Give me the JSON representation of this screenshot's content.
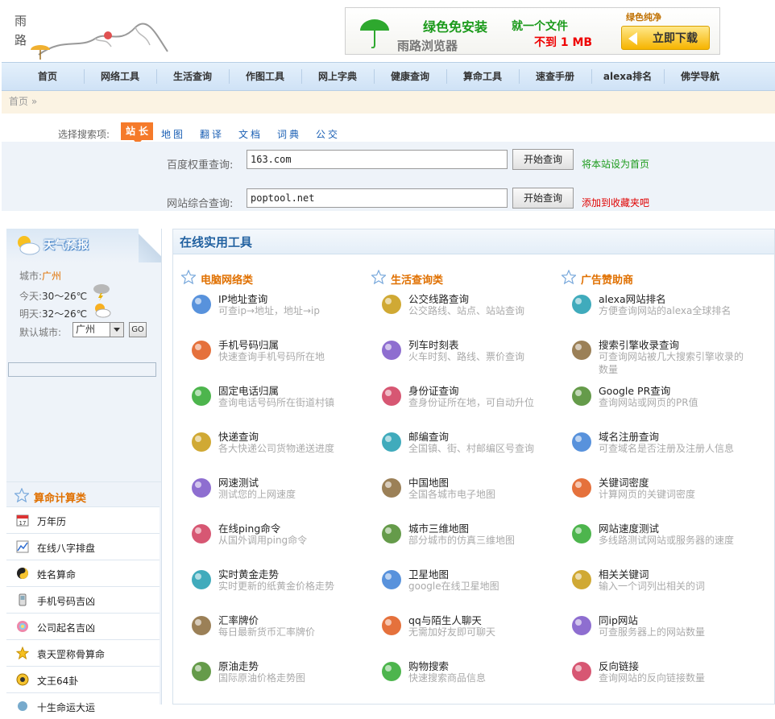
{
  "header": {
    "logo_text": "雨路",
    "banner": {
      "line1": "绿色免安装",
      "line2": "就一个文件",
      "line3": "雨路浏览器",
      "line4": "不到 1 MB",
      "line5": "绿色纯净",
      "download": "立即下载"
    }
  },
  "nav": {
    "items": [
      "首页",
      "网络工具",
      "生活查询",
      "作图工具",
      "网上字典",
      "健康查询",
      "算命工具",
      "速查手册",
      "alexa排名",
      "佛学导航"
    ]
  },
  "breadcrumb": "首页 »",
  "search": {
    "label": "选择搜索项:",
    "tabs": [
      "站长",
      "地图",
      "翻译",
      "文档",
      "词典",
      "公交"
    ],
    "rows": [
      {
        "label": "百度权重查询:",
        "value": "163.com",
        "button": "开始查询",
        "link": "将本站设为首页",
        "link_color": "#1a9a1a"
      },
      {
        "label": "网站综合查询:",
        "value": "poptool.net",
        "button": "开始查询",
        "link": "添加到收藏夹吧",
        "link_color": "#e00000"
      }
    ]
  },
  "weather": {
    "title": "天气预报",
    "city_label": "城市:",
    "city": "广州",
    "today_label": "今天:",
    "today": "30～26℃",
    "tomorrow_label": "明天:",
    "tomorrow": "32～26℃",
    "default_label": "默认城市:",
    "default_city": "广州",
    "go": "GO"
  },
  "calc": {
    "title": "算命计算类",
    "items": [
      "万年历",
      "在线八字排盘",
      "姓名算命",
      "手机号码吉凶",
      "公司起名吉凶",
      "袁天罡称骨算命",
      "文王64卦",
      "十生命运大运"
    ]
  },
  "main": {
    "title": "在线实用工具",
    "columns": [
      {
        "title": "电脑网络类",
        "tools": [
          {
            "name": "IP地址查询",
            "desc": "可查ip→地址，地址→ip",
            "icon": "magnifier-icon"
          },
          {
            "name": "手机号码归属",
            "desc": "快速查询手机号码所在地",
            "icon": "mobile-phone-icon"
          },
          {
            "name": "固定电话归属",
            "desc": "查询电话号码所在街道村镇",
            "icon": "telephone-icon"
          },
          {
            "name": "快递查询",
            "desc": "各大快递公司货物递送进度",
            "icon": "truck-icon"
          },
          {
            "name": "网速测试",
            "desc": "测试您的上网速度",
            "icon": "computer-icon"
          },
          {
            "name": "在线ping命令",
            "desc": "从国外调用ping命令",
            "icon": "network-icon"
          },
          {
            "name": "实时黄金走势",
            "desc": "实时更新的纸黄金价格走势",
            "icon": "gold-icon"
          },
          {
            "name": "汇率牌价",
            "desc": "每日最新货币汇率牌价",
            "icon": "money-icon"
          },
          {
            "name": "原油走势",
            "desc": "国际原油价格走势图",
            "icon": "oil-fire-icon"
          }
        ]
      },
      {
        "title": "生活查询类",
        "tools": [
          {
            "name": "公交线路查询",
            "desc": "公交路线、站点、站站查询",
            "icon": "bus-icon"
          },
          {
            "name": "列车时刻表",
            "desc": "火车时刻、路线、票价查询",
            "icon": "train-icon"
          },
          {
            "name": "身份证查询",
            "desc": "查身份证所在地，可自动升位",
            "icon": "person-icon"
          },
          {
            "name": "邮编查询",
            "desc": "全国镇、街、村邮编区号查询",
            "icon": "envelope-icon"
          },
          {
            "name": "中国地图",
            "desc": "全国各城市电子地图",
            "icon": "compass-icon"
          },
          {
            "name": "城市三维地图",
            "desc": "部分城市的仿真三维地图",
            "icon": "city-map-icon"
          },
          {
            "name": "卫星地图",
            "desc": "google在线卫星地图",
            "icon": "satellite-icon"
          },
          {
            "name": "qq与陌生人聊天",
            "desc": "无需加好友即可聊天",
            "icon": "chat-icon"
          },
          {
            "name": "购物搜索",
            "desc": "快速搜索商品信息",
            "icon": "scale-icon"
          }
        ]
      },
      {
        "title": "广告赞助商",
        "tools": [
          {
            "name": "alexa网站排名",
            "desc": "方便查询网站的alexa全球排名",
            "icon": "bar-chart-icon"
          },
          {
            "name": "搜索引擎收录查询",
            "desc": "可查询网站被几大搜索引擎收录的数量",
            "icon": "search-engine-icon"
          },
          {
            "name": "Google PR查询",
            "desc": "查询网站或网页的PR值",
            "icon": "pr-icon"
          },
          {
            "name": "域名注册查询",
            "desc": "可查域名是否注册及注册人信息",
            "icon": "com-domain-icon"
          },
          {
            "name": "关键词密度",
            "desc": "计算网页的关键词密度",
            "icon": "balloons-icon"
          },
          {
            "name": "网站速度测试",
            "desc": "多线路测试网站或服务器的速度",
            "icon": "wings-icon"
          },
          {
            "name": "相关关键词",
            "desc": "输入一个词列出相关的词",
            "icon": "lock-icon"
          },
          {
            "name": "同ip网站",
            "desc": "可查服务器上的网站数量",
            "icon": "party-hat-icon"
          },
          {
            "name": "反向链接",
            "desc": "查询网站的反向链接数量",
            "icon": "firework-icon"
          }
        ]
      }
    ]
  },
  "colors": {
    "accent_orange": "#f57a2a",
    "link_blue": "#1a5fb4",
    "heading_orange": "#e07000",
    "nav_bg": "#d9e8f7"
  }
}
